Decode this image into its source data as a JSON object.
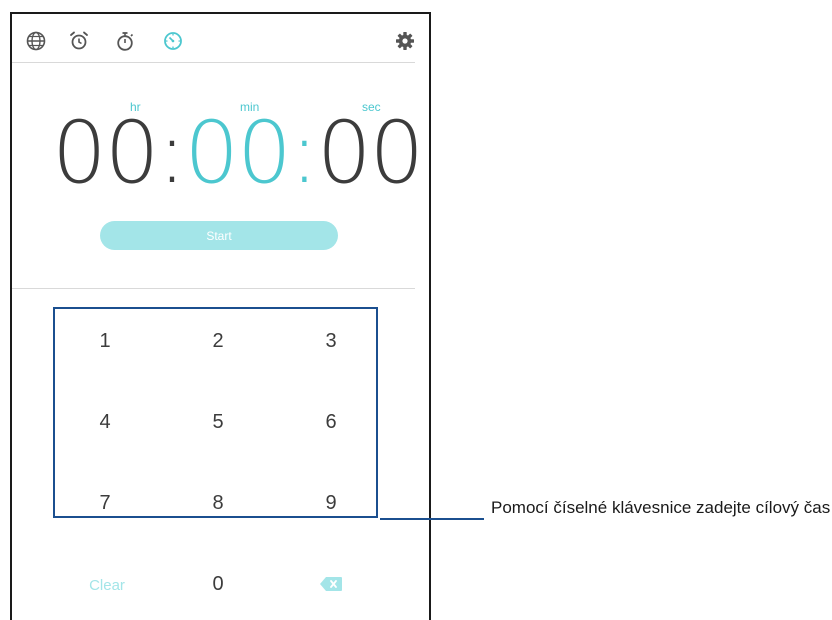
{
  "toolbar": {
    "tabs": [
      {
        "name": "world-clock",
        "icon": "globe-icon"
      },
      {
        "name": "alarm",
        "icon": "alarm-clock-icon"
      },
      {
        "name": "stopwatch",
        "icon": "stopwatch-icon"
      },
      {
        "name": "timer",
        "icon": "timer-icon",
        "active": true
      }
    ],
    "settings_icon": "gear-icon"
  },
  "timer": {
    "units": {
      "hr": "hr",
      "min": "min",
      "sec": "sec"
    },
    "hours": "00",
    "separator1": ":",
    "minutes": "00",
    "separator2": ":",
    "seconds": "00",
    "start_label": "Start"
  },
  "keypad": {
    "keys": [
      "1",
      "2",
      "3",
      "4",
      "5",
      "6",
      "7",
      "8",
      "9"
    ],
    "clear_label": "Clear",
    "zero": "0",
    "backspace_icon": "backspace-icon"
  },
  "callout": {
    "text": "Pomocí číselné klávesnice zadejte cílový čas"
  },
  "colors": {
    "accent": "#4cc7cf",
    "accent_light": "#a3e5e8",
    "text": "#3c3c3c",
    "callout_line": "#1b4f8f"
  }
}
